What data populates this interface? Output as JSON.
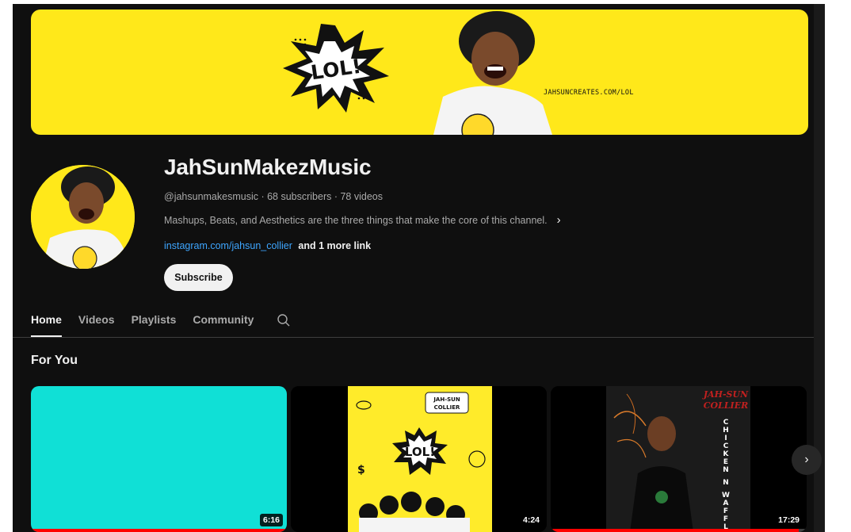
{
  "banner": {
    "burst_text": "LOL!",
    "url_text": "JAHSUNCREATES.COM/LOL"
  },
  "channel": {
    "name": "JahSunMakezMusic",
    "meta": "@jahsunmakesmusic · 68 subscribers · 78 videos",
    "description": "Mashups, Beats, and Aesthetics are the three things that make the core of this channel.",
    "link": "instagram.com/jahsun_collier",
    "more_links": "and 1 more link",
    "subscribe_label": "Subscribe"
  },
  "tabs": [
    {
      "label": "Home",
      "active": true
    },
    {
      "label": "Videos",
      "active": false
    },
    {
      "label": "Playlists",
      "active": false
    },
    {
      "label": "Community",
      "active": false
    }
  ],
  "section": {
    "title": "For You"
  },
  "videos": [
    {
      "duration": "6:16",
      "progress": 1.0,
      "thumb": "solid-cyan",
      "thumb_color": "#10e0d6"
    },
    {
      "duration": "4:24",
      "progress": 0.0,
      "thumb": "lol-album-art",
      "badge_text": "JAH-SUN COLLIER",
      "art_text": "LOL!"
    },
    {
      "duration": "17:29",
      "progress": 0.97,
      "thumb": "chicken-n-waffles-art",
      "art_title": "JAH-SUN COLLIER",
      "art_vertical": "CHICKEN N WAFFLES"
    }
  ],
  "icons": {
    "search": "search-icon",
    "next": "chevron-right-icon",
    "desc_more": "chevron-right-icon"
  },
  "colors": {
    "background": "#0f0f0f",
    "banner": "#ffe81a",
    "link": "#3ea6ff",
    "progress": "#ff0000"
  }
}
